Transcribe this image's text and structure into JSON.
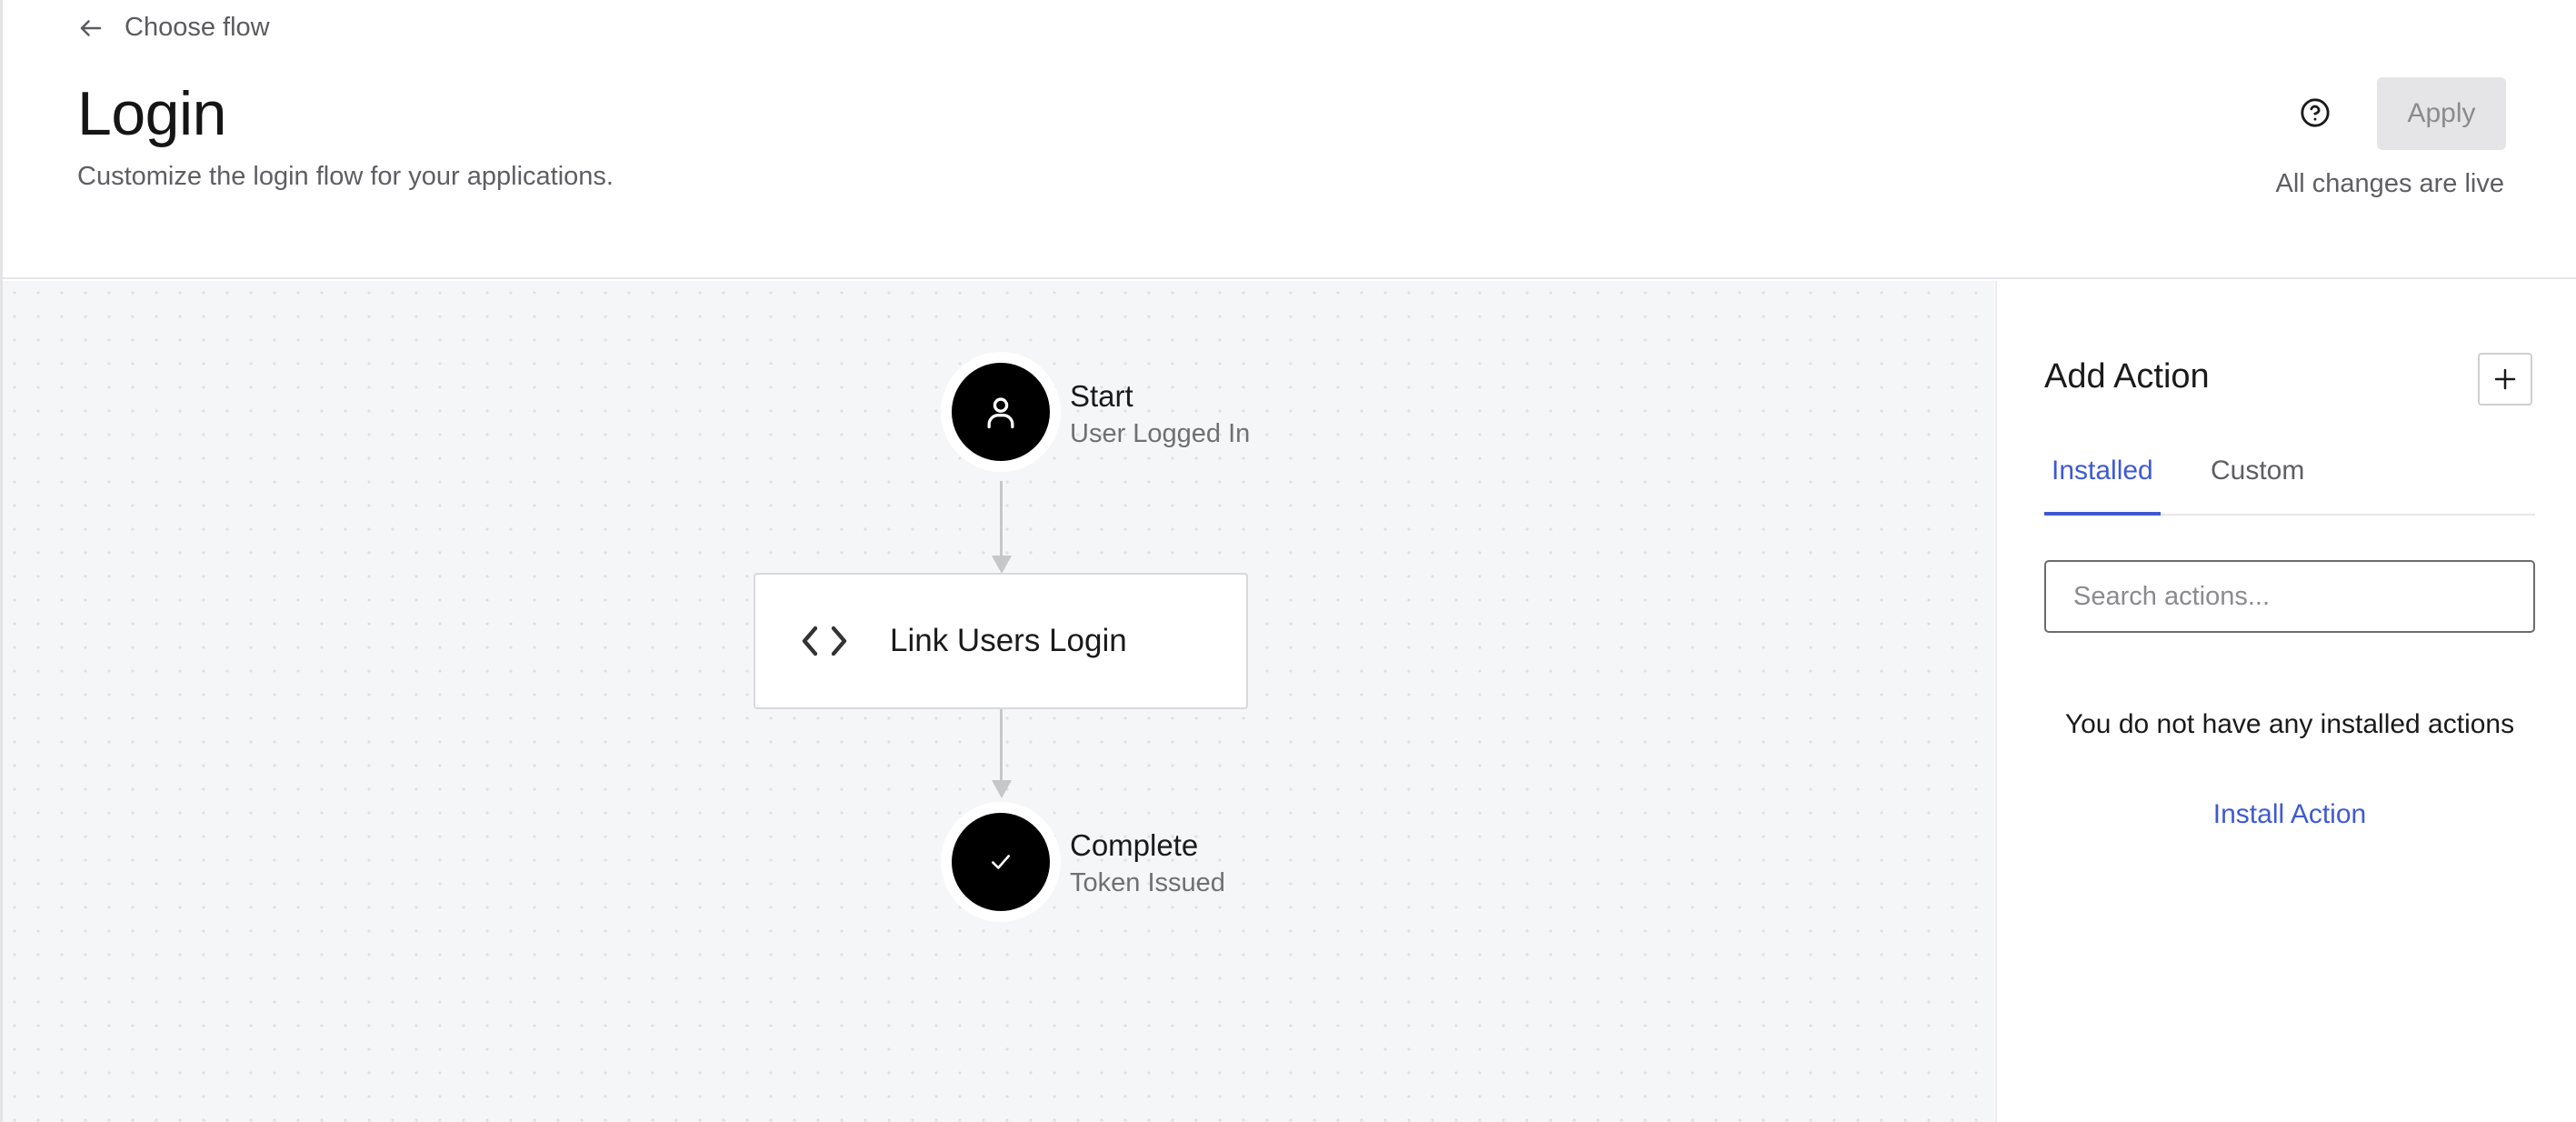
{
  "header": {
    "back_label": "Choose flow",
    "title": "Login",
    "subtitle": "Customize the login flow for your applications.",
    "apply_label": "Apply",
    "live_status": "All changes are live"
  },
  "flow": {
    "start": {
      "title": "Start",
      "subtitle": "User Logged In",
      "icon": "user-icon"
    },
    "action": {
      "label": "Link Users Login",
      "icon": "code-icon"
    },
    "complete": {
      "title": "Complete",
      "subtitle": "Token Issued",
      "icon": "check-icon"
    }
  },
  "panel": {
    "title": "Add Action",
    "tabs": [
      {
        "label": "Installed",
        "active": true
      },
      {
        "label": "Custom",
        "active": false
      }
    ],
    "search_placeholder": "Search actions...",
    "empty_message": "You do not have any installed actions",
    "install_link": "Install Action"
  },
  "colors": {
    "accent": "#3f59d4",
    "canvas_bg": "#f5f6f8",
    "node_fill": "#000000"
  }
}
